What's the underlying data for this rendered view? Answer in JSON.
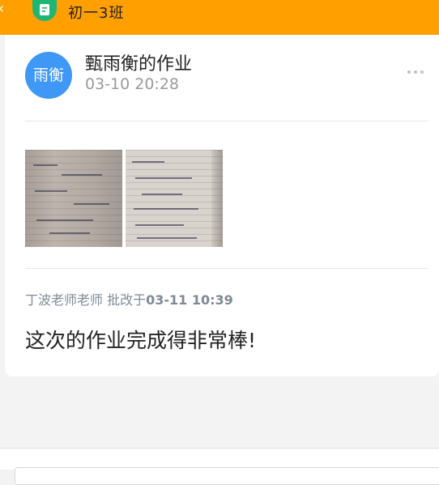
{
  "topbar": {
    "back_icon": "chevron-left-icon",
    "class_icon": "notebook-icon",
    "class_name": "初一3班",
    "color": "#ff9f00"
  },
  "post": {
    "avatar_text": "雨衡",
    "avatar_color": "#3f97f6",
    "title": "甄雨衡的作业",
    "time": "03-10 20:28",
    "more_icon": "more-dots-icon",
    "images": [
      "homework-photo-1",
      "homework-photo-2"
    ]
  },
  "review": {
    "teacher": "丁波老师老师",
    "label": "批改于",
    "time": "03-11 10:39",
    "comment": "这次的作业完成得非常棒!"
  }
}
